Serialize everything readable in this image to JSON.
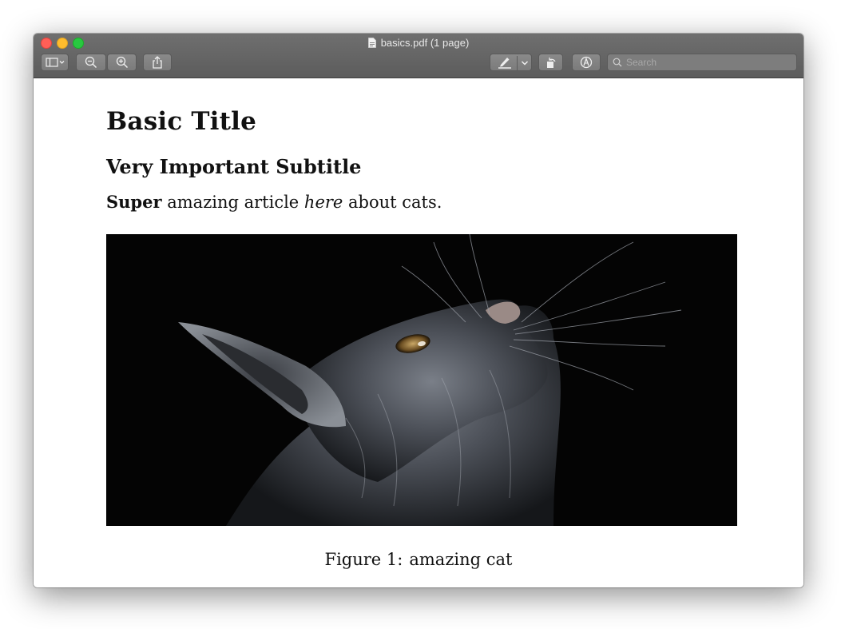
{
  "window": {
    "title": "basics.pdf (1 page)"
  },
  "toolbar": {
    "icons": [
      "sidebar-toggle-icon",
      "zoom-out-icon",
      "zoom-in-icon",
      "share-icon",
      "highlight-pen-icon",
      "chevron-down-icon",
      "rotate-icon",
      "markup-icon",
      "search-icon"
    ],
    "search_placeholder": "Search"
  },
  "document": {
    "title": "Basic Title",
    "subtitle": "Very Important Subtitle",
    "intro_bold": "Super",
    "intro_part1": "amazing article",
    "intro_italic": "here",
    "intro_part2": "about cats.",
    "figure_label": "Figure 1:",
    "figure_caption": "amazing cat"
  },
  "colors": {
    "titlebar": "#666666",
    "close": "#ff5f57",
    "minimize": "#febc2e",
    "zoom": "#28c840"
  }
}
